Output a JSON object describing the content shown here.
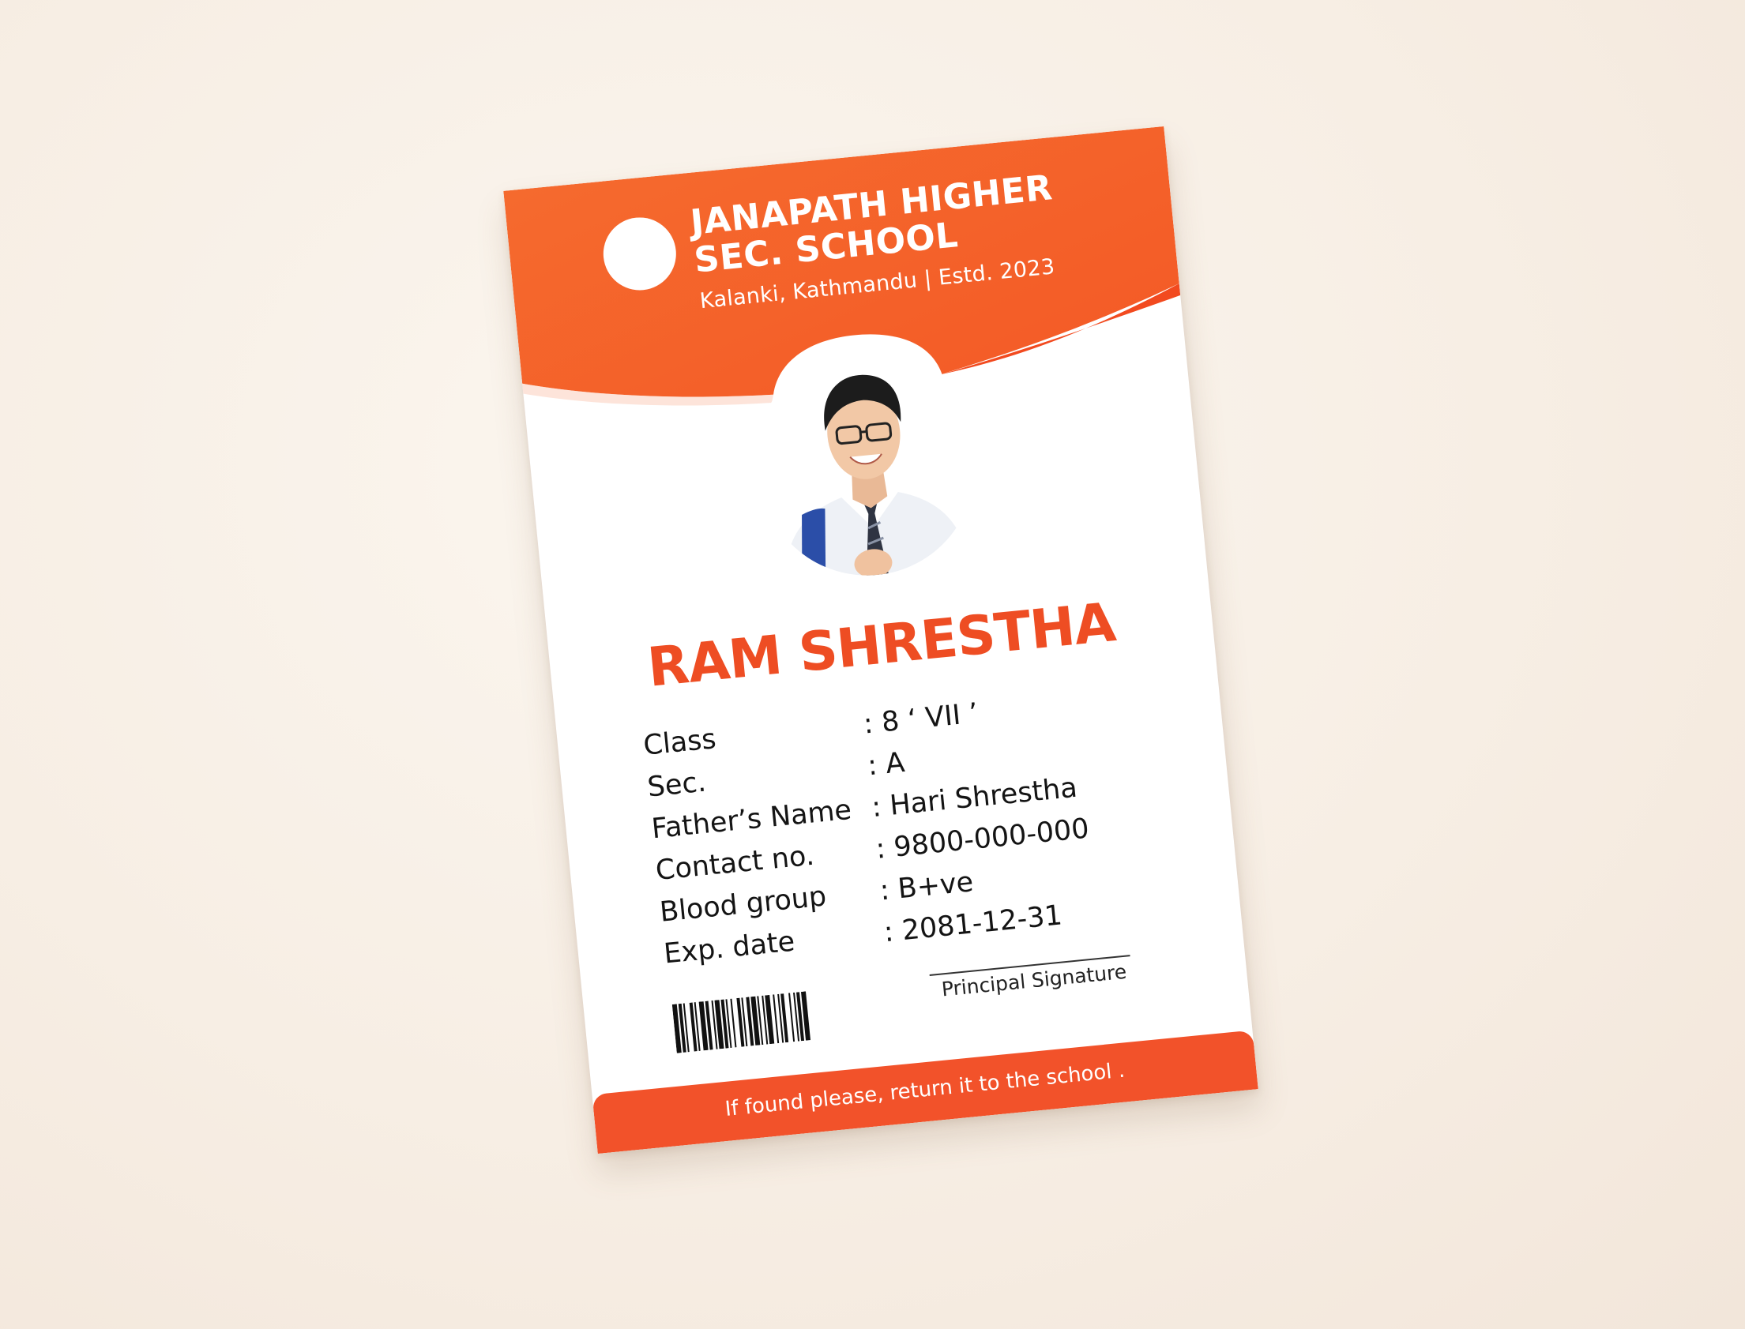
{
  "school": {
    "name": "JANAPATH HIGHER SEC. SCHOOL",
    "address": "Kalanki, Kathmandu | Estd. 2023"
  },
  "student": {
    "name": "RAM SHRESTHA"
  },
  "details": [
    {
      "label": "Class",
      "value": ": 8 ‘ VII ’"
    },
    {
      "label": "Sec.",
      "value": ": A"
    },
    {
      "label": "Father’s Name",
      "value": ": Hari Shrestha"
    },
    {
      "label": "Contact no.",
      "value": ": 9800-000-000"
    },
    {
      "label": "Blood group",
      "value": ": B+ve"
    },
    {
      "label": "Exp. date",
      "value": ": 2081-12-31"
    }
  ],
  "signature_label": "Principal Signature",
  "footer_text": "If found please, return it to the school .",
  "colors": {
    "primary": "#f7652c",
    "name_accent": "#ee4d23",
    "footer": "#f2522a"
  }
}
